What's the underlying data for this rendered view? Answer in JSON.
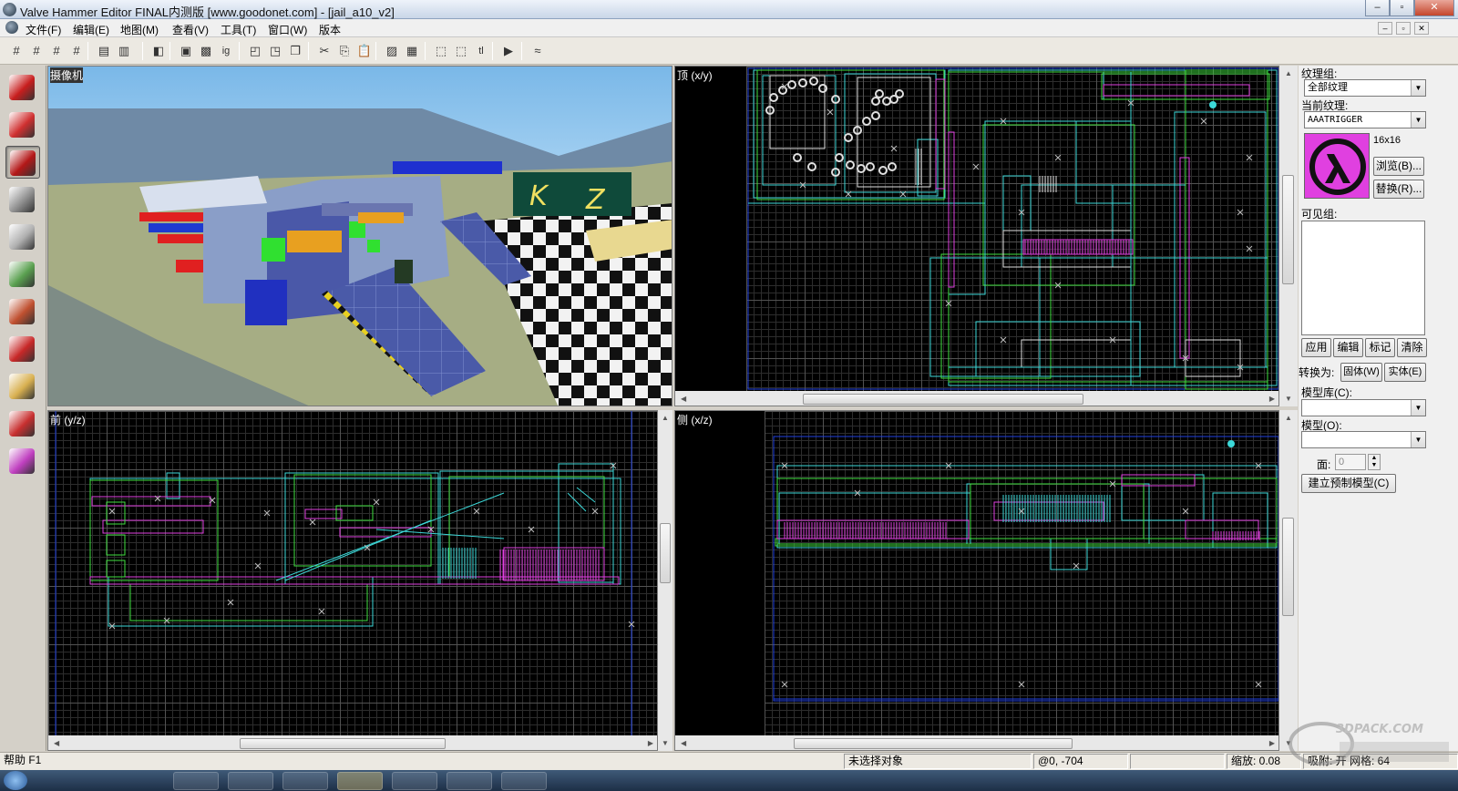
{
  "window": {
    "title": "Valve Hammer Editor FINAL内测版 [www.goodonet.com] - [jail_a10_v2]",
    "buttons": {
      "minimize": "–",
      "maximize": "▫",
      "close": "✕"
    }
  },
  "menu": {
    "items": [
      {
        "label": "文件(F)"
      },
      {
        "label": "编辑(E)"
      },
      {
        "label": "地图(M)"
      },
      {
        "label": "查看(V)"
      },
      {
        "label": "工具(T)"
      },
      {
        "label": "窗口(W)"
      },
      {
        "label": "版本"
      }
    ]
  },
  "toolbar": {
    "tools": [
      {
        "name": "grid-toggle-icon",
        "glyph": "#"
      },
      {
        "name": "grid-3d-icon",
        "glyph": "#"
      },
      {
        "name": "grid-smaller-icon",
        "glyph": "#"
      },
      {
        "name": "grid-larger-icon",
        "glyph": "#"
      },
      {
        "name": "group-icon",
        "glyph": "▤"
      },
      {
        "name": "ungroup-icon",
        "glyph": "▥"
      },
      {
        "name": "texture-lock-icon",
        "glyph": "◧"
      },
      {
        "name": "hide-icon",
        "glyph": "▣"
      },
      {
        "name": "show-icon",
        "glyph": "▩"
      },
      {
        "name": "ignore-groups-icon",
        "glyph": "ig"
      },
      {
        "name": "carve-icon",
        "glyph": "◰"
      },
      {
        "name": "hollow-icon",
        "glyph": "◳"
      },
      {
        "name": "clone-icon",
        "glyph": "❐"
      },
      {
        "name": "cut-icon",
        "glyph": "✂"
      },
      {
        "name": "copy-icon",
        "glyph": "⎘"
      },
      {
        "name": "paste-icon",
        "glyph": "📋"
      },
      {
        "name": "toggle-texture-icon",
        "glyph": "▨"
      },
      {
        "name": "decal-icon",
        "glyph": "▦"
      },
      {
        "name": "selection-box-icon",
        "glyph": "⬚"
      },
      {
        "name": "select-object-icon",
        "glyph": "⬚"
      },
      {
        "name": "tl-icon",
        "glyph": "tl"
      },
      {
        "name": "run-map-icon",
        "glyph": "▶"
      },
      {
        "name": "info-icon",
        "glyph": "≈"
      }
    ]
  },
  "left_tools": [
    {
      "name": "selection-tool-icon",
      "color": "#c81e1e"
    },
    {
      "name": "magnify-tool-icon",
      "color": "#d03030"
    },
    {
      "name": "camera-tool-icon",
      "color": "#b41818",
      "active": true
    },
    {
      "name": "entity-tool-icon",
      "color": "#909090"
    },
    {
      "name": "block-tool-icon",
      "color": "#b0b0b0"
    },
    {
      "name": "texture-application-icon",
      "color": "#5aa050"
    },
    {
      "name": "apply-texture-icon",
      "color": "#c05030"
    },
    {
      "name": "decal-tool-icon",
      "color": "#c82828"
    },
    {
      "name": "clip-tool-icon",
      "color": "#d8b050"
    },
    {
      "name": "vertex-tool-icon",
      "color": "#c83030"
    },
    {
      "name": "path-tool-icon",
      "color": "#c040c0"
    }
  ],
  "viewports": {
    "camera": {
      "label": "摄像机",
      "sign_letters": [
        "K",
        "Z"
      ]
    },
    "top": {
      "label": "顶 (x/y)"
    },
    "front": {
      "label": "前 (y/z)"
    },
    "side": {
      "label": "侧 (x/z)"
    }
  },
  "panel": {
    "texture_group_label": "纹理组:",
    "texture_group_value": "全部纹理",
    "current_texture_label": "当前纹理:",
    "current_texture_value": "AAATRIGGER",
    "texture_size": "16x16",
    "browse_button": "浏览(B)...",
    "replace_button": "替换(R)...",
    "visgroup_label": "可见组:",
    "apply_button": "应用",
    "edit_button": "编辑",
    "mark_button": "标记",
    "clear_button": "清除",
    "convert_label": "转换为:",
    "solid_button": "固体(W)",
    "entity_button": "实体(E)",
    "prefab_lib_label": "模型库(C):",
    "prefab_lib_value": "",
    "prefab_label": "模型(O):",
    "prefab_value": "",
    "faces_label": "面:",
    "faces_value": "0",
    "create_prefab_button": "建立预制模型(C)"
  },
  "status": {
    "help": "帮助 F1",
    "selection": "未选择对象",
    "coords": "@0, -704",
    "zoom": "缩放: 0.08",
    "snap": "吸附: 开 网格: 64"
  },
  "watermark": {
    "text": "3DPACK.COM"
  },
  "colors": {
    "cyan": "#3cd8d8",
    "green": "#40e040",
    "magenta": "#e040e0",
    "blue": "#2040e0",
    "white": "#e0e0e0"
  }
}
